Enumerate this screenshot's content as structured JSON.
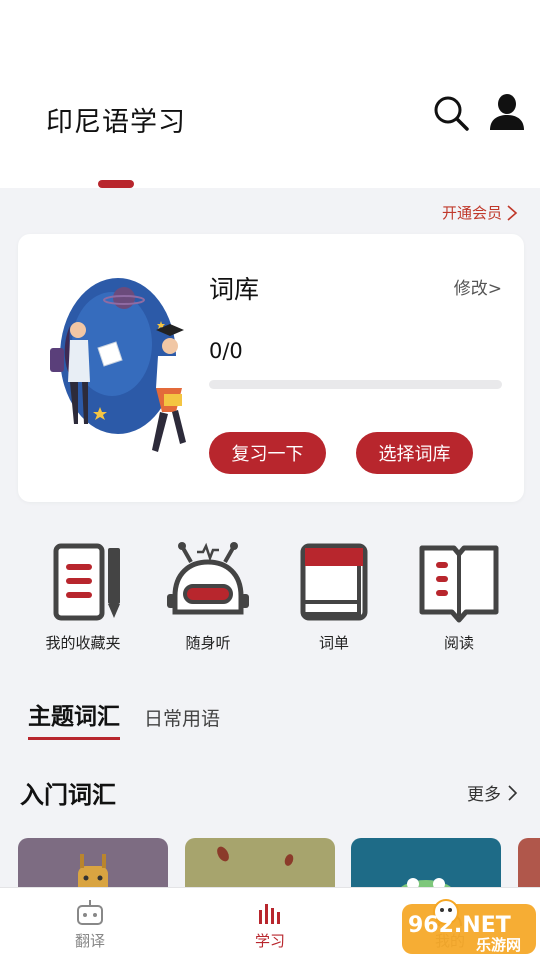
{
  "header": {
    "title": "印尼语学习"
  },
  "vip": {
    "label": "开通会员"
  },
  "vocab_card": {
    "title": "词库",
    "edit_label": "修改>",
    "progress_text": "0/0",
    "progress_fraction": 0,
    "review_button": "复习一下",
    "choose_button": "选择词库"
  },
  "features": [
    {
      "label": "我的收藏夹",
      "icon": "favorites-notebook-icon"
    },
    {
      "label": "随身听",
      "icon": "robot-radio-icon"
    },
    {
      "label": "词单",
      "icon": "word-book-icon"
    },
    {
      "label": "阅读",
      "icon": "open-book-icon"
    }
  ],
  "topic_tabs": [
    {
      "label": "主题词汇",
      "active": true
    },
    {
      "label": "日常用语",
      "active": false
    }
  ],
  "section": {
    "title": "入门词汇",
    "more_label": "更多"
  },
  "bottom_nav": [
    {
      "label": "翻译",
      "icon": "robot-icon",
      "active": false
    },
    {
      "label": "学习",
      "icon": "bars-icon",
      "active": true
    },
    {
      "label": "我的",
      "icon": "person-icon",
      "active": false
    }
  ],
  "watermark": {
    "text": "962.NET",
    "subtext": "乐游网"
  },
  "colors": {
    "accent": "#b8262d",
    "background": "#f2f3f6",
    "vip_text": "#c0392b"
  }
}
